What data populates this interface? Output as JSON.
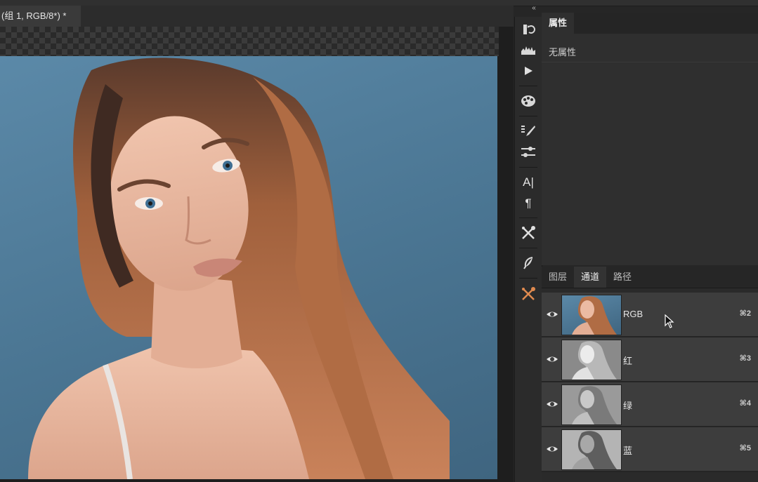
{
  "document": {
    "tab_title": "(组 1, RGB/8*) *"
  },
  "toolbar": {
    "collapse_glyph": "«",
    "tools": [
      "history-icon",
      "histogram-icon",
      "play-actions-icon",
      "color-palette-icon",
      "brush-presets-icon",
      "brush-settings-icon",
      "character-icon",
      "paragraph-icon",
      "tool-presets-icon",
      "feather-icon",
      "clone-source-icon"
    ],
    "character_glyph": "A|",
    "paragraph_glyph": "¶"
  },
  "properties": {
    "tab_label": "属性",
    "empty_text": "无属性"
  },
  "channels_panel": {
    "tabs": [
      {
        "label": "图层",
        "active": false
      },
      {
        "label": "通道",
        "active": true
      },
      {
        "label": "路径",
        "active": false
      }
    ],
    "channels": [
      {
        "name": "RGB",
        "shortcut": "⌘2",
        "mode": "color"
      },
      {
        "name": "红",
        "shortcut": "⌘3",
        "mode": "gray-light"
      },
      {
        "name": "绿",
        "shortcut": "⌘4",
        "mode": "gray-mid"
      },
      {
        "name": "蓝",
        "shortcut": "⌘5",
        "mode": "gray-dark"
      }
    ]
  },
  "colors": {
    "panel_bg": "#2f2f2f",
    "row_bg": "#3d3d3d",
    "backdrop_blue": "#4a7592",
    "hair": "#b56f45",
    "skin": "#e6b79f"
  }
}
